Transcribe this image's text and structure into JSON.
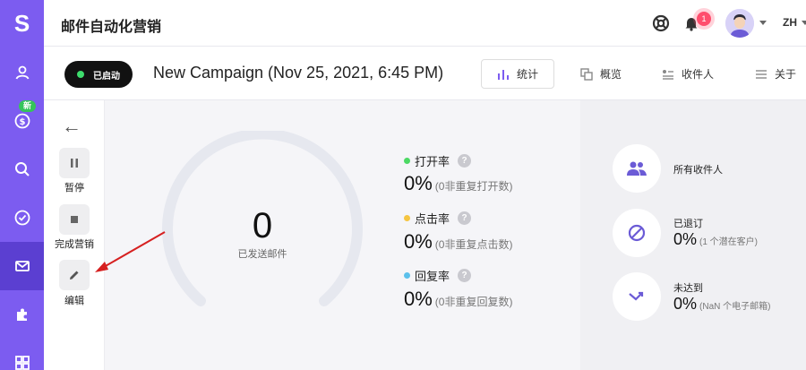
{
  "rail": {
    "logo": "S",
    "new_badge": "新",
    "items": [
      {
        "name": "contacts"
      },
      {
        "name": "billing"
      },
      {
        "name": "search"
      },
      {
        "name": "tasks"
      },
      {
        "name": "campaigns",
        "active": true
      },
      {
        "name": "integrations"
      },
      {
        "name": "apps"
      }
    ]
  },
  "header": {
    "title": "邮件自动化营销",
    "notification_count": "1",
    "language": "ZH"
  },
  "campaign": {
    "status": "已启动",
    "title": "New Campaign (Nov 25, 2021, 6:45 PM)",
    "tabs": {
      "stats": "统计",
      "overview": "概览",
      "recipients": "收件人",
      "about": "关于"
    }
  },
  "actions": {
    "pause": "暂停",
    "finish": "完成营销",
    "edit": "编辑"
  },
  "stats": {
    "sent_count": "0",
    "sent_label": "已发送邮件",
    "open": {
      "label": "打开率",
      "value": "0%",
      "detail": "(0非重复打开数)",
      "color": "#4cd964"
    },
    "click": {
      "label": "点击率",
      "value": "0%",
      "detail": "(0非重复点击数)",
      "color": "#f5c542"
    },
    "reply": {
      "label": "回复率",
      "value": "0%",
      "detail": "(0非重复回复数)",
      "color": "#5bc0eb"
    },
    "help": "?"
  },
  "recipients": {
    "all": "所有收件人",
    "unsubscribed": {
      "label": "已退订",
      "value": "0%",
      "detail": "(1 个潜在客户)"
    },
    "bounced": {
      "label": "未达到",
      "value": "0%",
      "detail": "(NaN 个电子邮箱)"
    }
  },
  "colors": {
    "rail": "#7c5cf0",
    "rail_active": "#5b3fd1",
    "accent": "#7c5cf0",
    "annotation_arrow": "#d62020"
  }
}
